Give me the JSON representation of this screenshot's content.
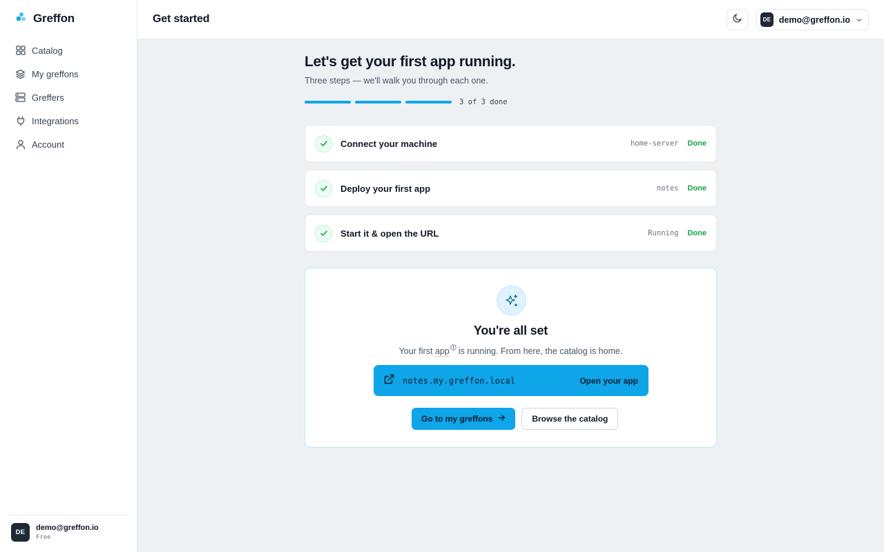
{
  "brand": {
    "name": "Greffon",
    "logo_icon": "greffon-logo-icon"
  },
  "sidebar": {
    "items": [
      {
        "label": "Catalog",
        "icon": "grid-icon"
      },
      {
        "label": "My greffons",
        "icon": "layers-icon"
      },
      {
        "label": "Greffers",
        "icon": "server-icon"
      },
      {
        "label": "Integrations",
        "icon": "plug-icon"
      },
      {
        "label": "Account",
        "icon": "user-icon"
      }
    ],
    "user": {
      "initials": "DE",
      "email": "demo@greffon.io",
      "plan": "Free"
    }
  },
  "header": {
    "title": "Get started",
    "theme_icon": "moon-icon",
    "user": {
      "initials": "DE",
      "email": "demo@greffon.io"
    }
  },
  "hero": {
    "title": "Let's get your first app running.",
    "subtitle": "Three steps — we'll walk you through each one.",
    "progress_text": "3 of 3 done",
    "progress_done": 3,
    "progress_total": 3
  },
  "steps": [
    {
      "title": "Connect your machine",
      "meta": "home-server",
      "status": "Done"
    },
    {
      "title": "Deploy your first app",
      "meta": "notes",
      "status": "Done"
    },
    {
      "title": "Start it & open the URL",
      "meta": "Running",
      "status": "Done"
    }
  ],
  "complete": {
    "title": "You're all set",
    "subtitle_pre": "Your first",
    "subtitle_app": "app",
    "subtitle_post": "is running. From here, the catalog is home.",
    "url": "notes.my.greffon.local",
    "open_label": "Open your app",
    "primary_label": "Go to my greffons",
    "secondary_label": "Browse the catalog"
  },
  "colors": {
    "accent": "#0ea5e9",
    "success": "#16a34a"
  }
}
